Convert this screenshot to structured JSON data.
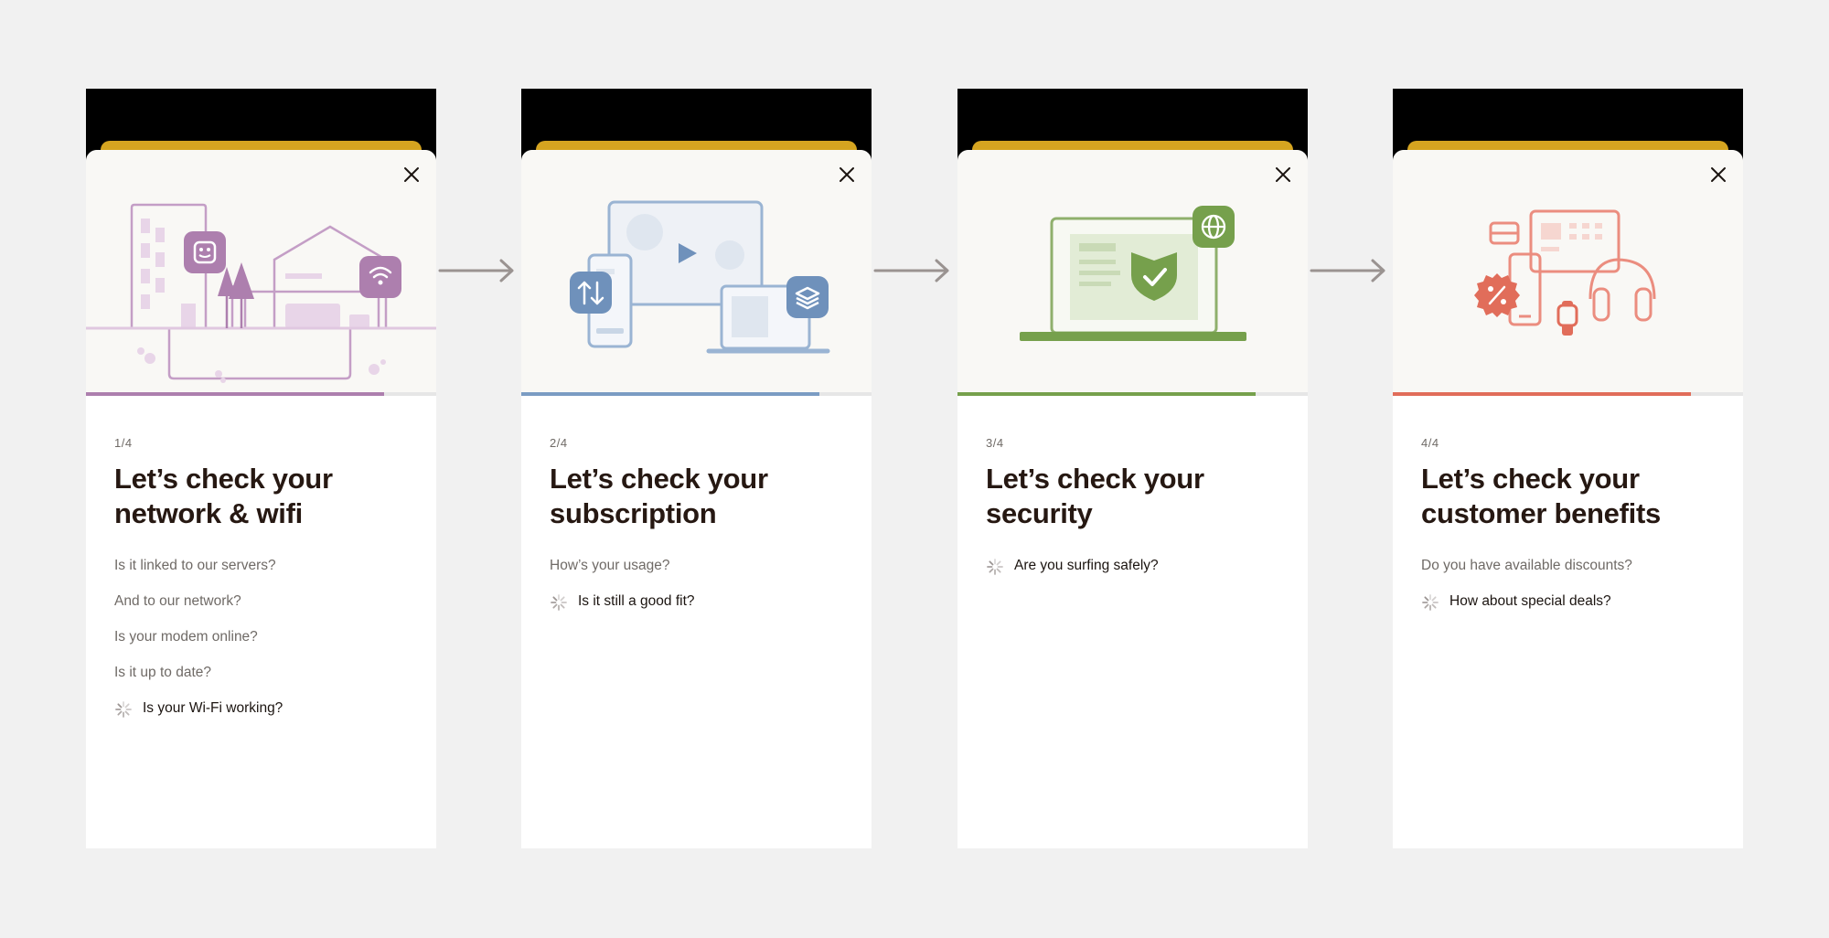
{
  "colors": {
    "page_bg": "#f1f1f1",
    "sheet_tab": "#d5a420",
    "network": "#ad7fae",
    "subscription": "#7b9cc3",
    "security": "#76a04c",
    "benefits": "#e16d5a",
    "arrow": "#9a9391"
  },
  "flow_arrows": [
    "arrow-right-icon",
    "arrow-right-icon",
    "arrow-right-icon"
  ],
  "cards": [
    {
      "id": "network",
      "illustration": "network-wifi-illustration",
      "close_icon": "close-icon",
      "progress": 0.85,
      "step": "1/4",
      "title_line1": "Let’s check your",
      "title_line2": "network & wifi",
      "questions": [
        {
          "text": "Is it linked to our servers?",
          "active": false
        },
        {
          "text": "And to our network?",
          "active": false
        },
        {
          "text": "Is your modem online?",
          "active": false
        },
        {
          "text": "Is it up to date?",
          "active": false
        },
        {
          "text": "Is your Wi-Fi working?",
          "active": true
        }
      ]
    },
    {
      "id": "subscription",
      "illustration": "subscription-devices-illustration",
      "close_icon": "close-icon",
      "progress": 0.85,
      "step": "2/4",
      "title_line1": "Let’s check your",
      "title_line2": "subscription",
      "questions": [
        {
          "text": "How’s your usage?",
          "active": false
        },
        {
          "text": "Is it still a good fit?",
          "active": true
        }
      ]
    },
    {
      "id": "security",
      "illustration": "security-laptop-shield-illustration",
      "close_icon": "close-icon",
      "progress": 0.85,
      "step": "3/4",
      "title_line1": "Let’s check your",
      "title_line2": "security",
      "questions": [
        {
          "text": "Are you surfing safely?",
          "active": true
        }
      ]
    },
    {
      "id": "benefits",
      "illustration": "customer-benefits-illustration",
      "close_icon": "close-icon",
      "progress": 0.85,
      "step": "4/4",
      "title_line1": "Let’s check your",
      "title_line2": "customer benefits",
      "questions": [
        {
          "text": "Do you have available discounts?",
          "active": false
        },
        {
          "text": "How about special deals?",
          "active": true
        }
      ]
    }
  ]
}
